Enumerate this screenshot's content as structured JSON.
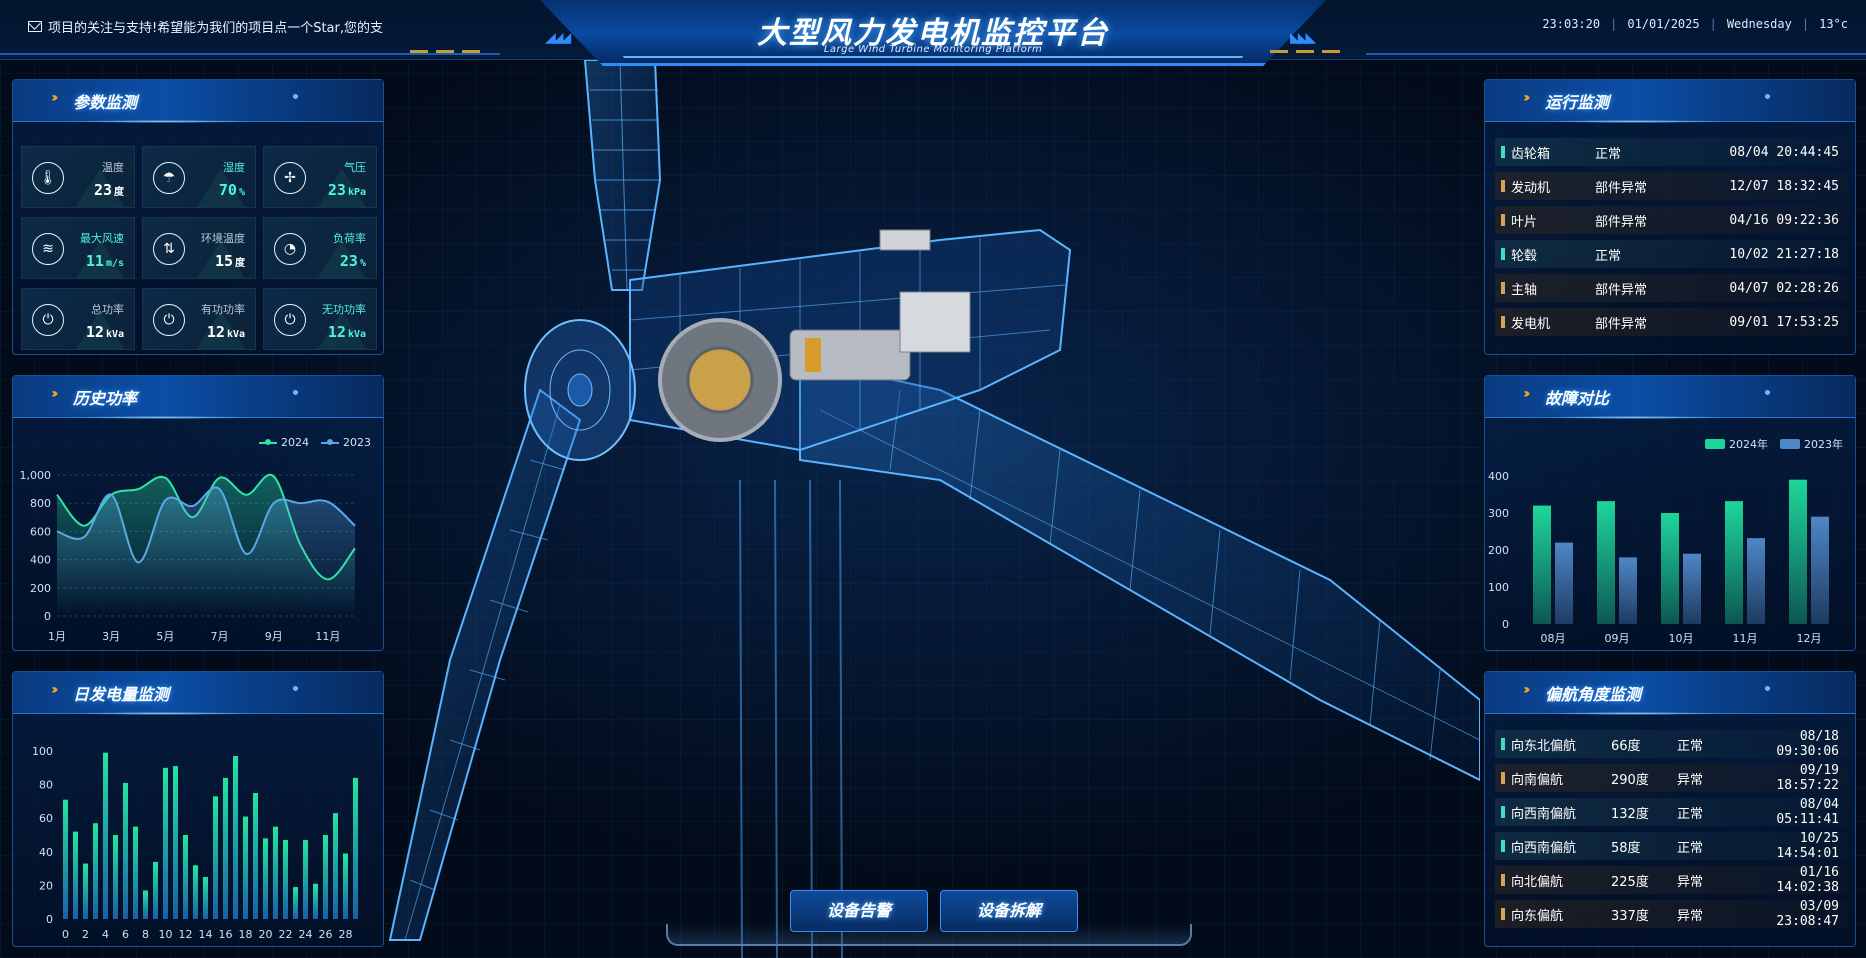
{
  "header": {
    "marquee": "项目的关注与支持!希望能为我们的项目点一个Star,您的支",
    "title": "大型风力发电机监控平台",
    "subtitle": "Large Wind Turbine Monitoring Platform",
    "time": "23:03:20",
    "date": "01/01/2025",
    "weekday": "Wednesday",
    "temperature": "13°c"
  },
  "params": {
    "title": "参数监测",
    "items": [
      {
        "label": "温度",
        "value": "23",
        "unit": "度",
        "icon": "thermometer-icon",
        "accent": false
      },
      {
        "label": "湿度",
        "value": "70",
        "unit": "%",
        "icon": "umbrella-icon",
        "accent": true
      },
      {
        "label": "气压",
        "value": "23",
        "unit": "kPa",
        "icon": "fan-icon",
        "accent": true
      },
      {
        "label": "最大风速",
        "value": "11",
        "unit": "m/s",
        "icon": "wind-icon",
        "accent": true
      },
      {
        "label": "环境温度",
        "value": "15",
        "unit": "度",
        "icon": "temperature-arrows-icon",
        "accent": false
      },
      {
        "label": "负荷率",
        "value": "23",
        "unit": "%",
        "icon": "gauge-icon",
        "accent": true
      },
      {
        "label": "总功率",
        "value": "12",
        "unit": "kVa",
        "icon": "plug-icon",
        "accent": false
      },
      {
        "label": "有功功率",
        "value": "12",
        "unit": "kVa",
        "icon": "plug-icon",
        "accent": false
      },
      {
        "label": "无功功率",
        "value": "12",
        "unit": "kVa",
        "icon": "plug-icon",
        "accent": true
      }
    ]
  },
  "history": {
    "title": "历史功率",
    "chart_data": {
      "type": "line",
      "x": [
        "1月",
        "2月",
        "3月",
        "4月",
        "5月",
        "6月",
        "7月",
        "8月",
        "9月",
        "10月",
        "11月",
        "12月"
      ],
      "xticks": [
        "1月",
        "3月",
        "5月",
        "7月",
        "9月",
        "11月"
      ],
      "yticks": [
        "0",
        "200",
        "400",
        "600",
        "800",
        "1,000"
      ],
      "ylim": [
        0,
        1000
      ],
      "series": [
        {
          "name": "2024",
          "color": "#2de6a4",
          "values": [
            860,
            640,
            860,
            900,
            980,
            700,
            980,
            860,
            990,
            500,
            260,
            480
          ]
        },
        {
          "name": "2023",
          "color": "#5aa9e6",
          "values": [
            600,
            560,
            860,
            380,
            820,
            780,
            900,
            440,
            800,
            800,
            810,
            640
          ]
        }
      ]
    }
  },
  "daily": {
    "title": "日发电量监测",
    "chart_data": {
      "type": "bar",
      "x": [
        0,
        1,
        2,
        3,
        4,
        5,
        6,
        7,
        8,
        9,
        10,
        11,
        12,
        13,
        14,
        15,
        16,
        17,
        18,
        19,
        20,
        21,
        22,
        23,
        24,
        25,
        26,
        27,
        28,
        29
      ],
      "xticks": [
        "0",
        "2",
        "4",
        "6",
        "8",
        "10",
        "12",
        "14",
        "16",
        "18",
        "20",
        "22",
        "24",
        "26",
        "28"
      ],
      "yticks": [
        "0",
        "20",
        "40",
        "60",
        "80",
        "100"
      ],
      "ylim": [
        0,
        100
      ],
      "values": [
        71,
        52,
        33,
        57,
        99,
        50,
        81,
        55,
        17,
        34,
        90,
        91,
        50,
        32,
        25,
        73,
        84,
        97,
        61,
        75,
        48,
        55,
        47,
        19,
        47,
        21,
        50,
        63,
        39,
        84
      ]
    }
  },
  "operation": {
    "title": "运行监测",
    "rows": [
      {
        "name": "齿轮箱",
        "status": "正常",
        "time": "08/04 20:44:45",
        "ok": true
      },
      {
        "name": "发动机",
        "status": "部件异常",
        "time": "12/07 18:32:45",
        "ok": false
      },
      {
        "name": "叶片",
        "status": "部件异常",
        "time": "04/16 09:22:36",
        "ok": false
      },
      {
        "name": "轮毂",
        "status": "正常",
        "time": "10/02 21:27:18",
        "ok": true
      },
      {
        "name": "主轴",
        "status": "部件异常",
        "time": "04/07 02:28:26",
        "ok": false
      },
      {
        "name": "发电机",
        "status": "部件异常",
        "time": "09/01 17:53:25",
        "ok": false
      }
    ]
  },
  "faults": {
    "title": "故障对比",
    "chart_data": {
      "type": "bar",
      "categories": [
        "08月",
        "09月",
        "10月",
        "11月",
        "12月"
      ],
      "yticks": [
        "0",
        "100",
        "200",
        "300",
        "400"
      ],
      "ylim": [
        0,
        400
      ],
      "series": [
        {
          "name": "2024年",
          "color": "#1ed69a",
          "values": [
            320,
            332,
            300,
            332,
            390
          ]
        },
        {
          "name": "2023年",
          "color": "#4f86c6",
          "values": [
            220,
            180,
            190,
            232,
            290
          ]
        }
      ]
    }
  },
  "yaw": {
    "title": "偏航角度监测",
    "rows": [
      {
        "dir": "向东北偏航",
        "angle": "66度",
        "status": "正常",
        "time": "08/18 09:30:06",
        "ok": true
      },
      {
        "dir": "向南偏航",
        "angle": "290度",
        "status": "异常",
        "time": "09/19 18:57:22",
        "ok": false
      },
      {
        "dir": "向西南偏航",
        "angle": "132度",
        "status": "正常",
        "time": "08/04 05:11:41",
        "ok": true
      },
      {
        "dir": "向西南偏航",
        "angle": "58度",
        "status": "正常",
        "time": "10/25 14:54:01",
        "ok": true
      },
      {
        "dir": "向北偏航",
        "angle": "225度",
        "status": "异常",
        "time": "01/16 14:02:38",
        "ok": false
      },
      {
        "dir": "向东偏航",
        "angle": "337度",
        "status": "异常",
        "time": "03/09 23:08:47",
        "ok": false
      }
    ]
  },
  "buttons": {
    "alarm": "设备告警",
    "disassemble": "设备拆解"
  }
}
